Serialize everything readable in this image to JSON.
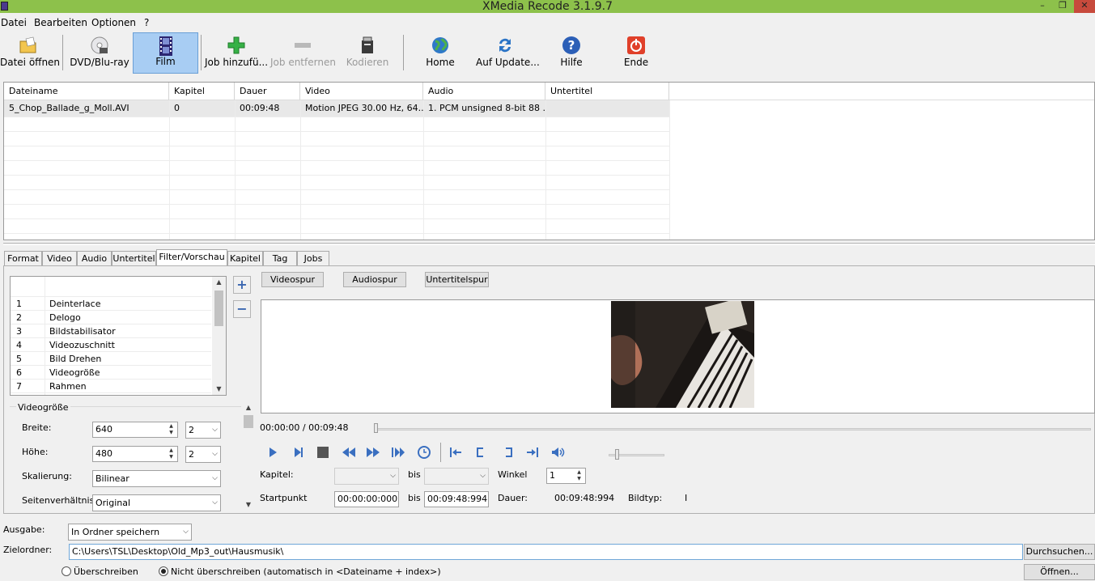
{
  "window": {
    "title": "XMedia Recode 3.1.9.7",
    "minimize": "–",
    "maximize": "❐",
    "close": "✕"
  },
  "menu": [
    "Datei",
    "Bearbeiten",
    "Optionen",
    "?"
  ],
  "toolbar": {
    "open": "Datei öffnen",
    "dvd": "DVD/Blu-ray",
    "film": "Film",
    "add_job": "Job hinzufü...",
    "remove_job": "Job entfernen",
    "encode": "Kodieren",
    "home": "Home",
    "update": "Auf Update...",
    "help": "Hilfe",
    "exit": "Ende"
  },
  "filelist": {
    "columns": [
      "Dateiname",
      "Kapitel",
      "Dauer",
      "Video",
      "Audio",
      "Untertitel"
    ],
    "rows": [
      [
        "5_Chop_Ballade_g_Moll.AVI",
        "0",
        "00:09:48",
        "Motion JPEG 30.00 Hz, 64...",
        "1. PCM unsigned 8-bit 88 ...",
        ""
      ]
    ]
  },
  "tabs": [
    "Format",
    "Video",
    "Audio",
    "Untertitel",
    "Filter/Vorschau",
    "Kapitel",
    "Tag",
    "Jobs"
  ],
  "filters": [
    {
      "n": "1",
      "name": "Deinterlace"
    },
    {
      "n": "2",
      "name": "Delogo"
    },
    {
      "n": "3",
      "name": "Bildstabilisator"
    },
    {
      "n": "4",
      "name": "Videozuschnitt"
    },
    {
      "n": "5",
      "name": "Bild Drehen"
    },
    {
      "n": "6",
      "name": "Videogröße"
    },
    {
      "n": "7",
      "name": "Rahmen"
    }
  ],
  "filter_buttons": {
    "add": "+",
    "remove": "−"
  },
  "videosize": {
    "group_label": "Videogröße",
    "width_label": "Breite:",
    "width_value": "640",
    "width_step": "2",
    "height_label": "Höhe:",
    "height_value": "480",
    "height_step": "2",
    "scaling_label": "Skalierung:",
    "scaling_value": "Bilinear",
    "aspect_label": "Seitenverhältnis",
    "aspect_value": "Original"
  },
  "track_buttons": {
    "video": "Videospur",
    "audio": "Audiospur",
    "subtitle": "Untertitelspur"
  },
  "player": {
    "time": "00:00:00 / 00:09:48",
    "position": 0,
    "volume": 0.13
  },
  "chapter": {
    "label": "Kapitel:",
    "to": "bis",
    "angle_label": "Winkel",
    "angle_value": "1"
  },
  "range": {
    "start_label": "Startpunkt",
    "start_value": "00:00:00:000",
    "to": "bis",
    "end_value": "00:09:48:994",
    "duration_label": "Dauer:",
    "duration_value": "00:09:48:994",
    "frametype_label": "Bildtyp:",
    "frametype_value": "I"
  },
  "output": {
    "label": "Ausgabe:",
    "value": "In Ordner speichern",
    "folder_label": "Zielordner:",
    "folder_value": "C:\\Users\\TSL\\Desktop\\Old_Mp3_out\\Hausmusik\\",
    "browse": "Durchsuchen...",
    "open": "Öffnen...",
    "overwrite": "Überschreiben",
    "no_overwrite": "Nicht überschreiben (automatisch in <Dateiname + index>)"
  }
}
